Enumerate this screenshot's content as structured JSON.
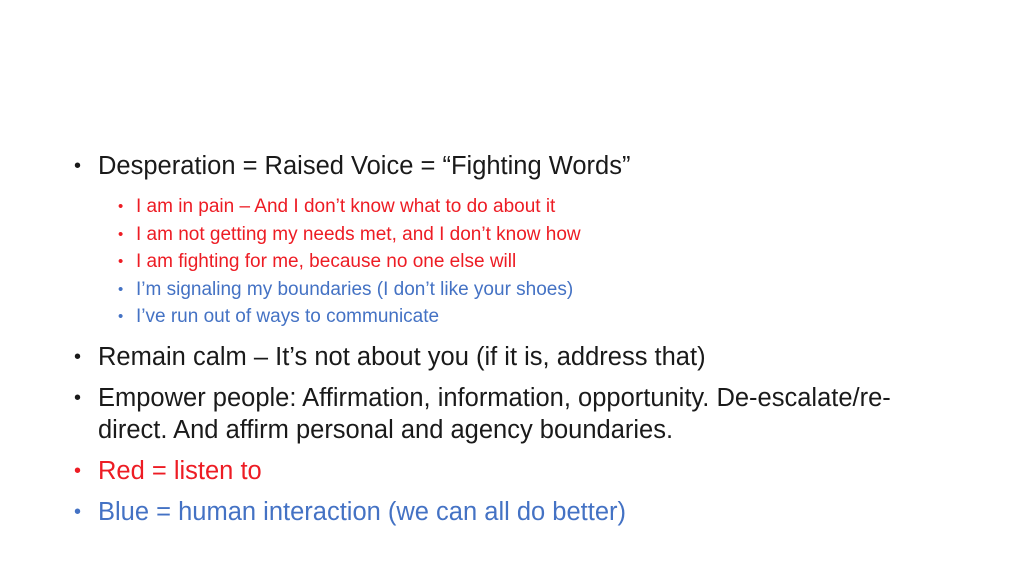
{
  "slide": {
    "background_color": "#FFFFFF",
    "colors": {
      "text_black": "#1A1A1A",
      "text_red": "#ED1C24",
      "text_blue": "#4472C4"
    },
    "bullet_glyph": "•",
    "body": [
      {
        "level": 1,
        "color": "black",
        "text": "Desperation = Raised Voice = “Fighting Words”"
      },
      {
        "level": 2,
        "color": "red",
        "text": "I am in pain – And I don’t know what to do about it"
      },
      {
        "level": 2,
        "color": "red",
        "text": "I am not getting my needs met, and I don’t know how"
      },
      {
        "level": 2,
        "color": "red",
        "text": "I am fighting for me, because no one else will"
      },
      {
        "level": 2,
        "color": "blue",
        "text": "I’m signaling my boundaries (I don’t like your shoes)"
      },
      {
        "level": 2,
        "color": "blue",
        "text": "I’ve run out of ways to communicate"
      },
      {
        "level": 1,
        "color": "black",
        "text": "Remain calm – It’s not about you (if it is, address that)"
      },
      {
        "level": 1,
        "color": "black",
        "text": "Empower people: Affirmation, information, opportunity. De-escalate/re-direct. And affirm personal and agency boundaries."
      },
      {
        "level": 1,
        "color": "red",
        "text": "Red = listen to"
      },
      {
        "level": 1,
        "color": "blue",
        "text": "Blue = human interaction (we can all do better)"
      }
    ]
  }
}
